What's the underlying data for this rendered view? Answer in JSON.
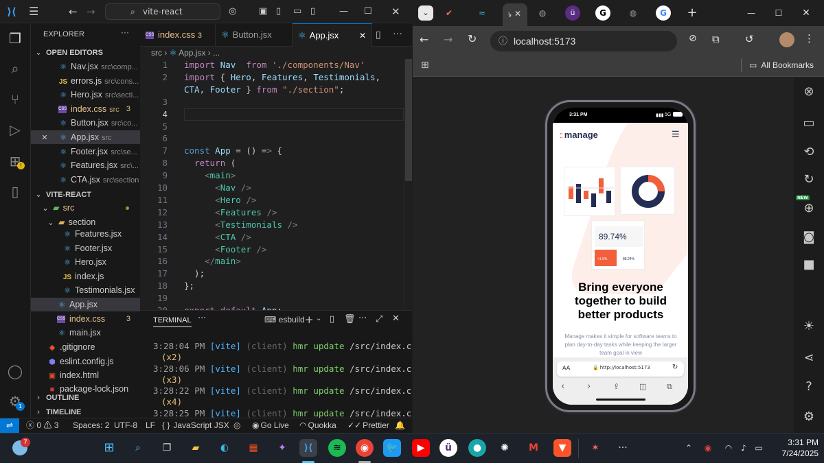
{
  "vscode": {
    "search": "vite-react",
    "explorer_title": "EXPLORER",
    "open_editors_header": "OPEN EDITORS",
    "open_editors": [
      {
        "name": "Nav.jsx",
        "path": "src\\comp...",
        "type": "react",
        "badge": ""
      },
      {
        "name": "errors.js",
        "path": "src\\cons...",
        "type": "js",
        "badge": ""
      },
      {
        "name": "Hero.jsx",
        "path": "src\\secti...",
        "type": "react",
        "badge": ""
      },
      {
        "name": "index.css",
        "path": "src",
        "type": "css",
        "badge": "3"
      },
      {
        "name": "Button.jsx",
        "path": "src\\co...",
        "type": "react",
        "badge": ""
      },
      {
        "name": "App.jsx",
        "path": "src",
        "type": "react",
        "badge": ""
      },
      {
        "name": "Footer.jsx",
        "path": "src\\se...",
        "type": "react",
        "badge": ""
      },
      {
        "name": "Features.jsx",
        "path": "src\\...",
        "type": "react",
        "badge": ""
      },
      {
        "name": "CTA.jsx",
        "path": "src\\section",
        "type": "react",
        "badge": ""
      }
    ],
    "project_header": "VITE-REACT",
    "folder_src": "src",
    "folder_section": "section",
    "tree_files": [
      {
        "name": "Features.jsx",
        "type": "react",
        "indent": 2,
        "badge": ""
      },
      {
        "name": "Footer.jsx",
        "type": "react",
        "indent": 2,
        "badge": ""
      },
      {
        "name": "Hero.jsx",
        "type": "react",
        "indent": 2,
        "badge": ""
      },
      {
        "name": "index.js",
        "type": "js",
        "indent": 2,
        "badge": ""
      },
      {
        "name": "Testimonials.jsx",
        "type": "react",
        "indent": 2,
        "badge": ""
      },
      {
        "name": "App.jsx",
        "type": "react",
        "indent": 1,
        "badge": ""
      },
      {
        "name": "index.css",
        "type": "css",
        "indent": 1,
        "badge": "3"
      },
      {
        "name": "main.jsx",
        "type": "react",
        "indent": 1,
        "badge": ""
      },
      {
        "name": ".gitignore",
        "type": "git",
        "indent": 0,
        "badge": ""
      },
      {
        "name": "eslint.config.js",
        "type": "eslint",
        "indent": 0,
        "badge": ""
      },
      {
        "name": "index.html",
        "type": "html",
        "indent": 0,
        "badge": ""
      },
      {
        "name": "package-lock.json",
        "type": "npm",
        "indent": 0,
        "badge": ""
      }
    ],
    "outline": "OUTLINE",
    "timeline": "TIMELINE",
    "tabs": [
      {
        "label": "index.css",
        "badge": "3"
      },
      {
        "label": "Button.jsx",
        "badge": ""
      },
      {
        "label": "App.jsx",
        "badge": ""
      }
    ],
    "breadcrumb": {
      "folder": "src",
      "file": "App.jsx",
      "more": "..."
    },
    "code_lines": [
      {
        "n": "1",
        "t": "import Nav  from './components/Nav'"
      },
      {
        "n": "2",
        "t": "import { Hero, Features, Testimonials,"
      },
      {
        "n": "",
        "t": "CTA, Footer } from \"./section\";"
      },
      {
        "n": "3",
        "t": ""
      },
      {
        "n": "4",
        "t": ""
      },
      {
        "n": "5",
        "t": ""
      },
      {
        "n": "6",
        "t": ""
      },
      {
        "n": "7",
        "t": "const App = () => {"
      },
      {
        "n": "8",
        "t": "  return ("
      },
      {
        "n": "9",
        "t": "    <main>"
      },
      {
        "n": "10",
        "t": "      <Nav />"
      },
      {
        "n": "11",
        "t": "      <Hero />"
      },
      {
        "n": "12",
        "t": "      <Features />"
      },
      {
        "n": "13",
        "t": "      <Testimonials />"
      },
      {
        "n": "14",
        "t": "      <CTA />"
      },
      {
        "n": "15",
        "t": "      <Footer />"
      },
      {
        "n": "16",
        "t": "    </main>"
      },
      {
        "n": "17",
        "t": "  );"
      },
      {
        "n": "18",
        "t": "};"
      },
      {
        "n": "19",
        "t": ""
      },
      {
        "n": "20",
        "t": "export default App;"
      }
    ],
    "terminal": {
      "title": "TERMINAL",
      "shell": "esbuild",
      "lines": [
        {
          "time": "3:28:04 PM",
          "count": "(x2)"
        },
        {
          "time": "3:28:06 PM",
          "count": "(x3)"
        },
        {
          "time": "3:28:22 PM",
          "count": "(x4)"
        },
        {
          "time": "3:28:25 PM",
          "count": ""
        }
      ],
      "vite": "[vite]",
      "client": "(client)",
      "msg": "hmr update",
      "path": "/src/index.css"
    },
    "status": {
      "errors": "0",
      "warnings": "3",
      "spaces": "Spaces: 2",
      "encoding": "UTF-8",
      "eol": "LF",
      "language": "JavaScript JSX",
      "golive": "Go Live",
      "quokka": "Quokka",
      "prettier": "Prettier",
      "account_badge": "1"
    }
  },
  "browser": {
    "url": "localhost:5173",
    "bookmarks": "All Bookmarks",
    "devtools_new": "NEW"
  },
  "phone": {
    "time": "3:31 PM",
    "signal": "5G",
    "logo": "manage",
    "stat": "89.74%",
    "stat_small_1": "+1.5%",
    "stat_small_2": "88.24%",
    "headline": "Bring everyone together to build better products",
    "subtext": "Manage makes it simple for software teams to plan day-to-day tasks while keeping the larger team goal in view",
    "aa": "AA",
    "address": "http://localhost:5173"
  },
  "taskbar": {
    "weather_badge": "7",
    "time": "3:31 PM",
    "date": "7/24/2025"
  },
  "colors": {
    "accent": "#0078d4",
    "brand_orange": "#f25f3a",
    "brand_navy": "#242d52"
  }
}
